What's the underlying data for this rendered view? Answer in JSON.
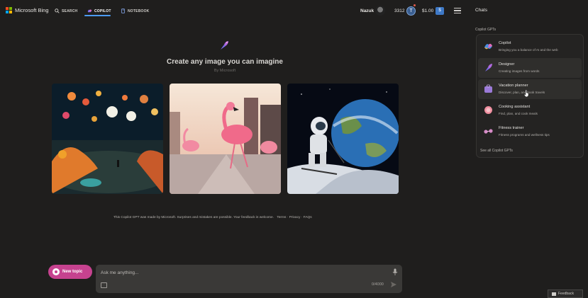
{
  "header": {
    "logo_text": "Microsoft Bing",
    "nav": [
      {
        "label": "SEARCH",
        "icon": "search-icon"
      },
      {
        "label": "COPILOT",
        "icon": "copilot-icon"
      },
      {
        "label": "NOTEBOOK",
        "icon": "notebook-icon"
      }
    ],
    "active_tab": "COPILOT",
    "user_name": "Nazuk",
    "points": "3312",
    "reward_icon": "T",
    "balance": "$1.00",
    "balance_icon": "$",
    "chats_label": "Chats"
  },
  "hero": {
    "icon": "designer-icon",
    "title": "Create any image you can imagine",
    "subtitle": "By Microsoft"
  },
  "gallery": [
    {
      "name": "lantern-forest-image"
    },
    {
      "name": "flamingo-street-image"
    },
    {
      "name": "astronaut-earth-image"
    }
  ],
  "disclaimer": {
    "text": "This Copilot GPT was made by Microsoft. Surprises and mistakes are possible. Your feedback is welcome.",
    "links": [
      "Terms",
      "Privacy",
      "FAQs"
    ]
  },
  "composer": {
    "new_topic_label": "New topic",
    "placeholder": "Ask me anything...",
    "counter": "0/4000"
  },
  "copilot_gpts": {
    "label": "Copilot GPTs",
    "items": [
      {
        "name": "Copilot",
        "desc": "Bringing you a balance of AI and the web",
        "icon": "copilot-icon",
        "color": "#4a8fe0"
      },
      {
        "name": "Designer",
        "desc": "Creating images from words",
        "icon": "designer-icon",
        "color": "#8b5cf6"
      },
      {
        "name": "Vacation planner",
        "desc": "Discover, plan, and book travels",
        "icon": "suitcase-icon",
        "color": "#9b7ad8"
      },
      {
        "name": "Cooking assistant",
        "desc": "Find, plan, and cook meals",
        "icon": "bowl-icon",
        "color": "#f08fa0"
      },
      {
        "name": "Fitness trainer",
        "desc": "Fitness programs and wellness tips",
        "icon": "dumbbell-icon",
        "color": "#d58ac6"
      }
    ],
    "see_all_label": "See all Copilot GPTs"
  },
  "feedback_label": "Feedback",
  "colors": {
    "background": "#1f1e1d",
    "accent_pink": "#c6428f",
    "tab_underline": "#4c9bf5"
  }
}
